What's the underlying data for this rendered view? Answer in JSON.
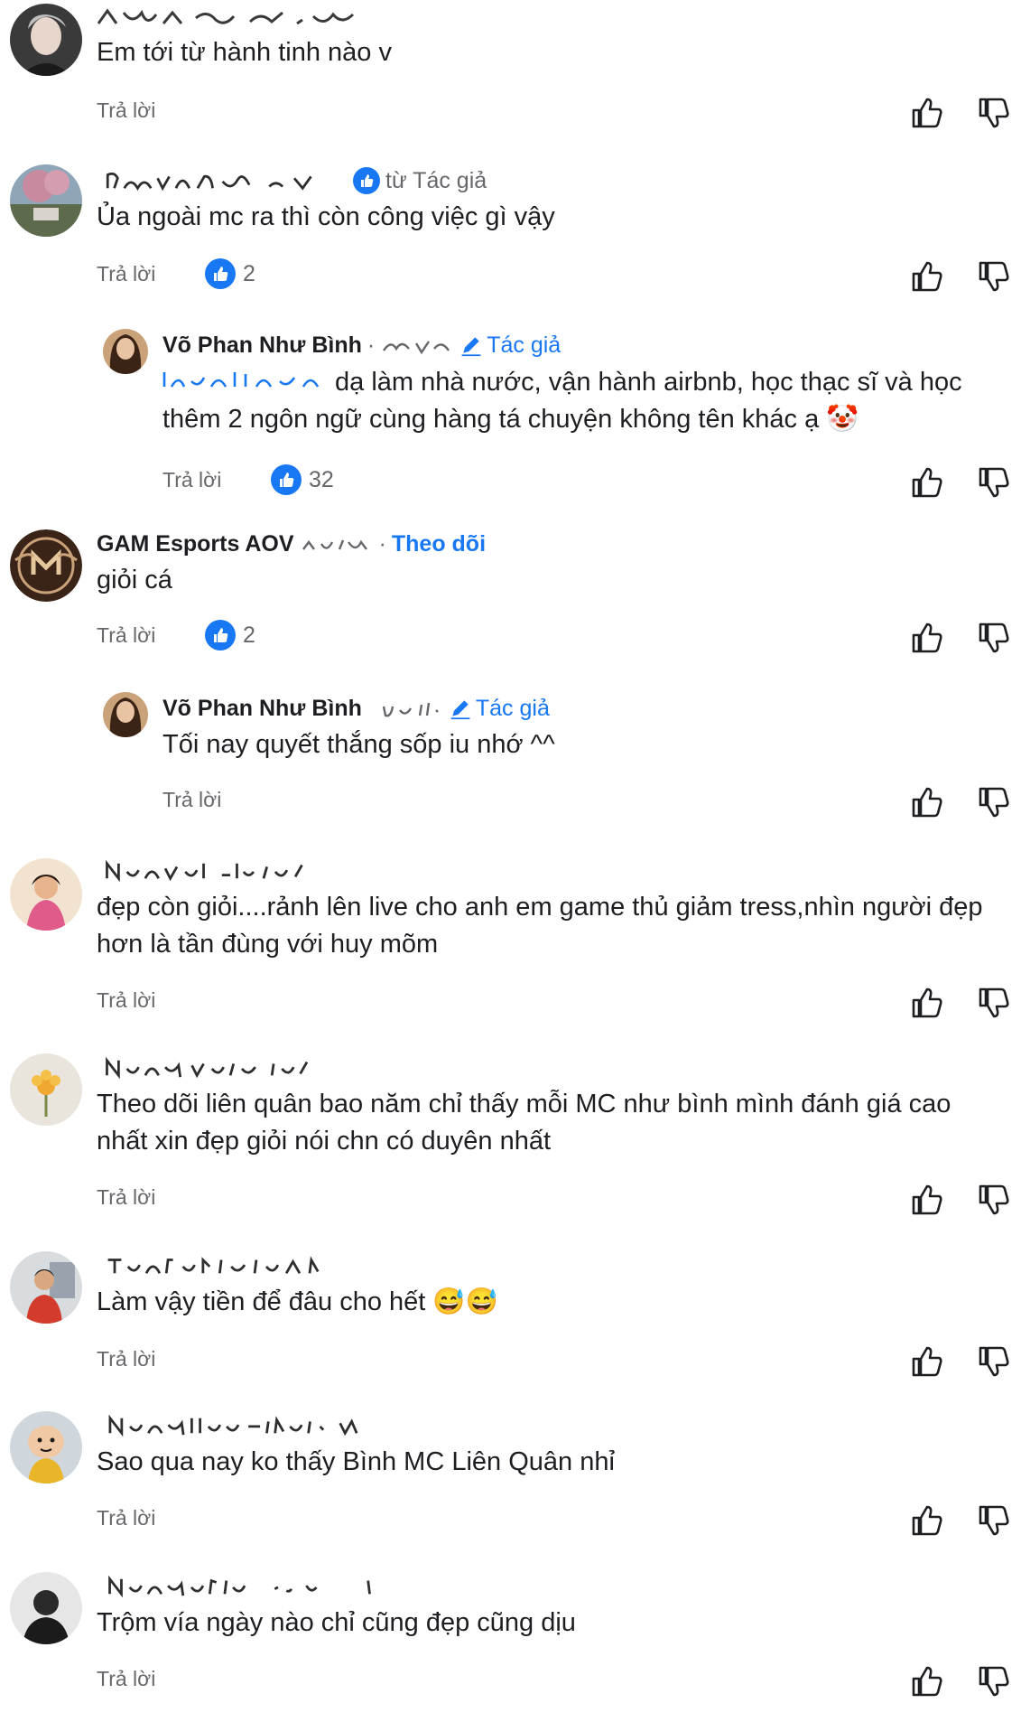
{
  "colors": {
    "link": "#1877f2",
    "muted": "#65676b",
    "text": "#1c1e21"
  },
  "labels": {
    "reply": "Trả lời",
    "from_author": "từ Tác giả",
    "author": "Tác giả",
    "follow": "Theo dõi",
    "separator": "·"
  },
  "comments": [
    {
      "body": "Em tới từ hành tinh nào v"
    },
    {
      "body": "Ủa ngoài mc ra thì còn công việc gì vậy",
      "likes": "2"
    },
    {
      "name": "Võ Phan Như Bình",
      "body": "dạ làm nhà nước, vận hành airbnb, học thạc sĩ và học thêm 2 ngôn ngữ cùng hàng tá chuyện không tên khác ạ 🤡",
      "likes": "32"
    },
    {
      "name": "GAM Esports AOV",
      "body": "giỏi cá",
      "likes": "2"
    },
    {
      "name": "Võ Phan Như Bình",
      "body": "Tối nay quyết thắng sốp iu nhớ ^^"
    },
    {
      "body": "đẹp còn giỏi....rảnh lên live cho anh em game thủ giảm tress,nhìn người đẹp hơn là tần đùng với huy mõm"
    },
    {
      "body": "Theo dõi liên quân bao năm chỉ thấy mỗi MC như bình mình đánh giá cao nhất xin đẹp giỏi nói chn có duyên nhất"
    },
    {
      "body": "Làm vậy tiền để đâu cho hết 😅😅"
    },
    {
      "body": "Sao qua nay ko thấy Bình MC Liên Quân nhỉ"
    },
    {
      "body": "Trộm vía ngày nào chỉ cũng đẹp cũng dịu"
    }
  ]
}
